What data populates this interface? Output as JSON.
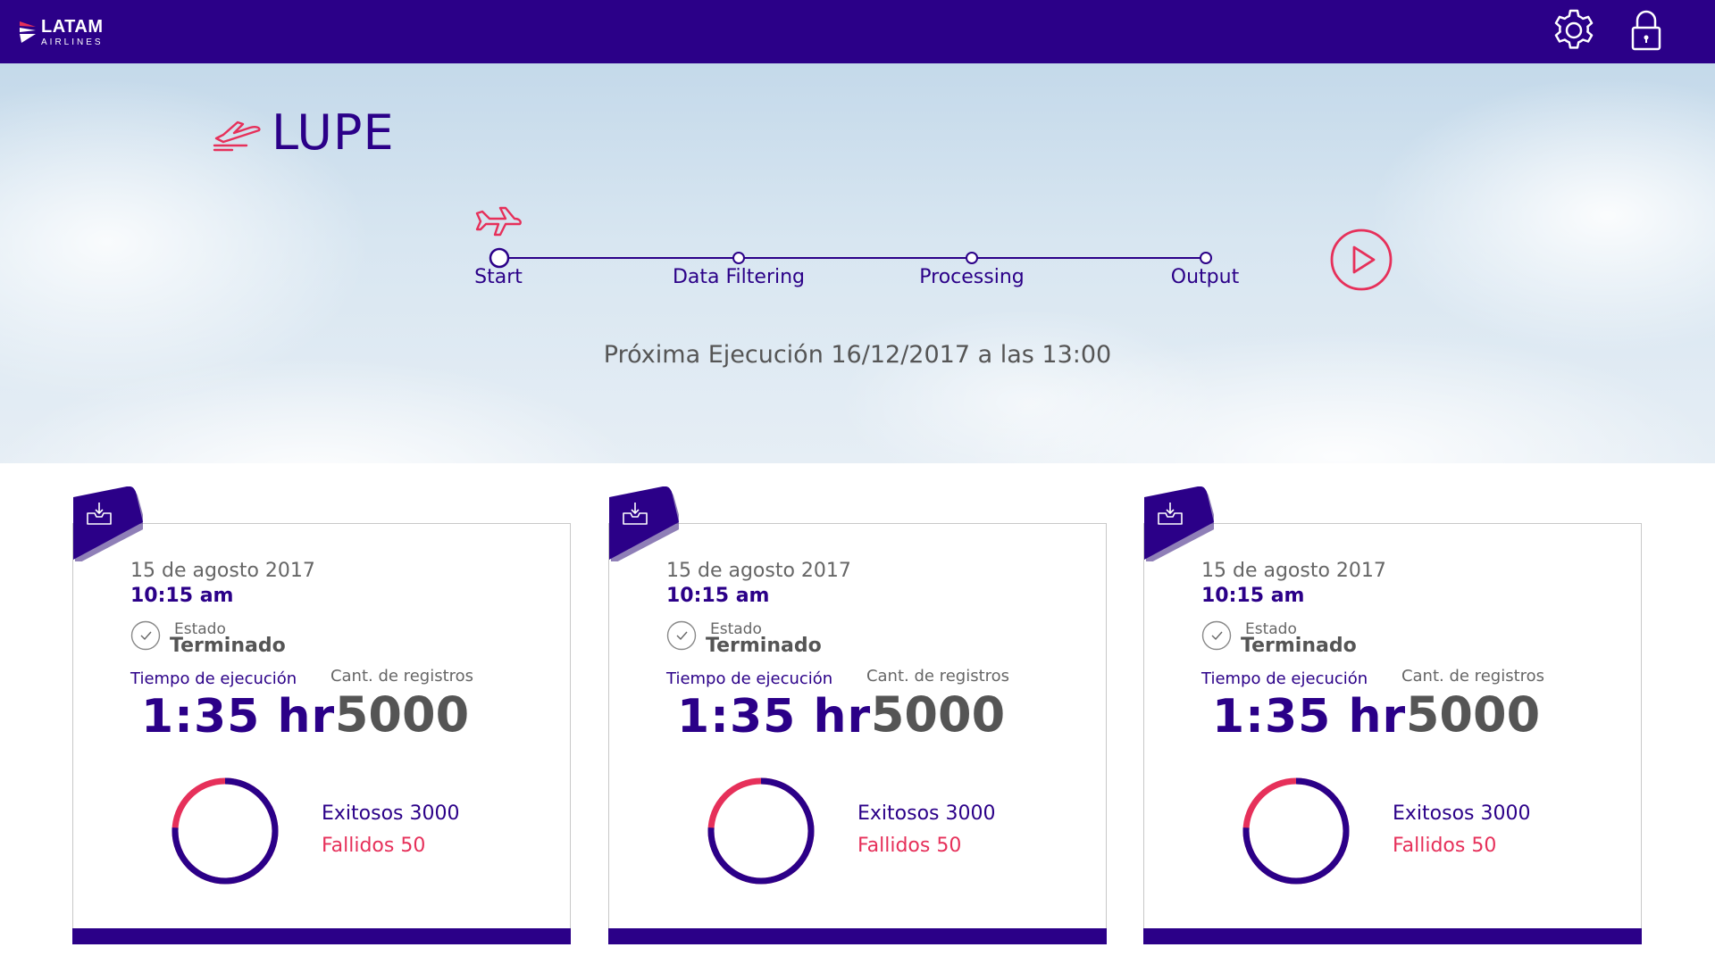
{
  "header": {
    "logo_main": "LATAM",
    "logo_sub": "AIRLINES",
    "icons": [
      "gear-icon",
      "lock-icon"
    ]
  },
  "app": {
    "title": "LUPE"
  },
  "pipeline": {
    "steps": [
      {
        "label": "Start",
        "current": true
      },
      {
        "label": "Data Filtering"
      },
      {
        "label": "Processing"
      },
      {
        "label": "Output"
      }
    ],
    "next_run": "Próxima Ejecución 16/12/2017 a las 13:00"
  },
  "colors": {
    "brand": "#2b0088",
    "accent": "#e6305a"
  },
  "cards": [
    {
      "date": "15 de agosto 2017",
      "time": "10:15 am",
      "status_label": "Estado",
      "status_value": "Terminado",
      "exec_label": "Tiempo de ejecución",
      "exec_value": "1:35 hr",
      "records_label": "Cant. de registros",
      "records_value": "5000",
      "success_text": "Exitosos 3000",
      "failed_text": "Fallidos 50",
      "success_share": 0.76
    },
    {
      "date": "15 de agosto 2017",
      "time": "10:15 am",
      "status_label": "Estado",
      "status_value": "Terminado",
      "exec_label": "Tiempo de ejecución",
      "exec_value": "1:35 hr",
      "records_label": "Cant. de registros",
      "records_value": "5000",
      "success_text": "Exitosos 3000",
      "failed_text": "Fallidos 50",
      "success_share": 0.76
    },
    {
      "date": "15 de agosto 2017",
      "time": "10:15 am",
      "status_label": "Estado",
      "status_value": "Terminado",
      "exec_label": "Tiempo de ejecución",
      "exec_value": "1:35 hr",
      "records_label": "Cant. de registros",
      "records_value": "5000",
      "success_text": "Exitosos 3000",
      "failed_text": "Fallidos 50",
      "success_share": 0.76
    }
  ]
}
